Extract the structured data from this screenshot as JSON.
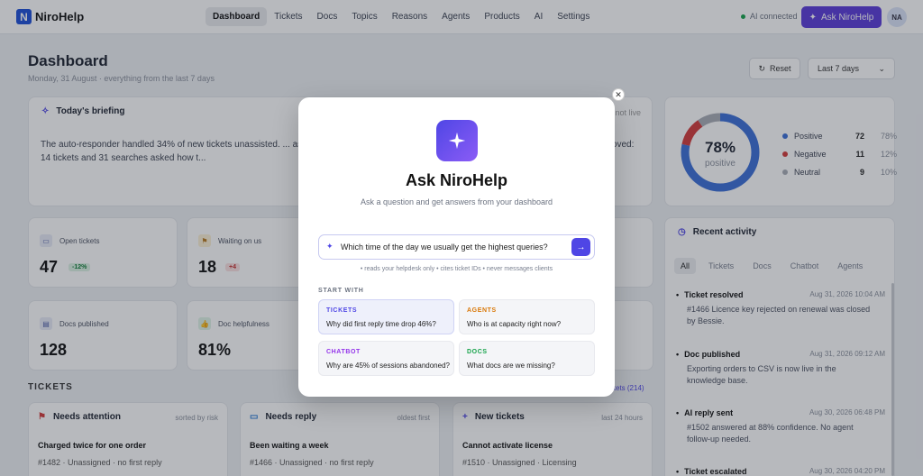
{
  "app": {
    "name": "NiroHelp",
    "logo_letter": "N"
  },
  "nav": {
    "items": [
      "Dashboard",
      "Tickets",
      "Docs",
      "Topics",
      "Reasons",
      "Agents",
      "Products",
      "AI",
      "Settings"
    ],
    "active": "Dashboard",
    "ai_status": "AI connected",
    "ask_button": "Ask NiroHelp",
    "avatar_initials": "NA"
  },
  "header": {
    "title": "Dashboard",
    "subtitle": "Monday, 31 August · everything from the last 7 days",
    "reset_label": "Reset",
    "range_label": "Last 7 days"
  },
  "briefing": {
    "title": "Today's briefing",
    "tag": "not live",
    "text": "The auto-responder handled 34% of new tickets unassisted. ... asked how to export a CSV, and no doc covers it.The auto-r... est gap has not moved: 14 tickets and 31 searches asked how t..."
  },
  "sentiment": {
    "percent": "78%",
    "label": "positive",
    "rows": [
      {
        "name": "Positive",
        "count": "72",
        "pct": "78%",
        "color": "#3b6fd8"
      },
      {
        "name": "Negative",
        "count": "11",
        "pct": "12%",
        "color": "#d33a3a"
      },
      {
        "name": "Neutral",
        "count": "9",
        "pct": "10%",
        "color": "#a9adb6"
      }
    ],
    "chart_values": [
      72,
      11,
      9
    ]
  },
  "stats": [
    {
      "label": "Open tickets",
      "value": "47",
      "delta": "-12%"
    },
    {
      "label": "Waiting on us",
      "value": "18",
      "delta": "+4"
    },
    {
      "label": "Docs published",
      "value": "128"
    },
    {
      "label": "Doc helpfulness",
      "value": "81%"
    }
  ],
  "tickets": {
    "section": "TICKETS",
    "see_all": "ckets (214)",
    "columns": [
      {
        "title": "Needs attention",
        "hint": "sorted by risk",
        "item_title": "Charged twice for one order",
        "item_sub": "#1482 · Unassigned · no first reply"
      },
      {
        "title": "Needs reply",
        "hint": "oldest first",
        "item_title": "Been waiting a week",
        "item_sub": "#1466 · Unassigned · no first reply"
      },
      {
        "title": "New tickets",
        "hint": "last 24 hours",
        "item_title": "Cannot activate license",
        "item_sub": "#1510 · Unassigned · Licensing"
      }
    ]
  },
  "activity": {
    "title": "Recent activity",
    "tabs": [
      "All",
      "Tickets",
      "Docs",
      "Chatbot",
      "Agents"
    ],
    "items": [
      {
        "title": "Ticket resolved",
        "time": "Aug 31, 2026 10:04 AM",
        "body": "#1466 Licence key rejected on renewal was closed by Bessie."
      },
      {
        "title": "Doc published",
        "time": "Aug 31, 2026 09:12 AM",
        "body": "Exporting orders to CSV is now live in the knowledge base."
      },
      {
        "title": "AI reply sent",
        "time": "Aug 30, 2026 06:48 PM",
        "body": "#1502 answered at 88% confidence. No agent follow-up needed."
      },
      {
        "title": "Ticket escalated",
        "time": "Aug 30, 2026 04:20 PM",
        "body": ""
      }
    ]
  },
  "modal": {
    "title": "Ask NiroHelp",
    "subtitle": "Ask a question and get answers from your dashboard",
    "input_value": "Which time of the day we usually get the highest queries?",
    "hints": "• reads your helpdesk only  • cites ticket IDs  • never messages clients",
    "start_label": "START WITH",
    "suggestions": [
      {
        "tag": "TICKETS",
        "question": "Why did first reply time drop 46%?",
        "color": "#4f46e5"
      },
      {
        "tag": "AGENTS",
        "question": "Who is at capacity right now?",
        "color": "#d97706"
      },
      {
        "tag": "CHATBOT",
        "question": "Why are 45% of sessions abandoned?",
        "color": "#9333ea"
      },
      {
        "tag": "DOCS",
        "question": "What docs are we missing?",
        "color": "#16a34a"
      }
    ]
  }
}
